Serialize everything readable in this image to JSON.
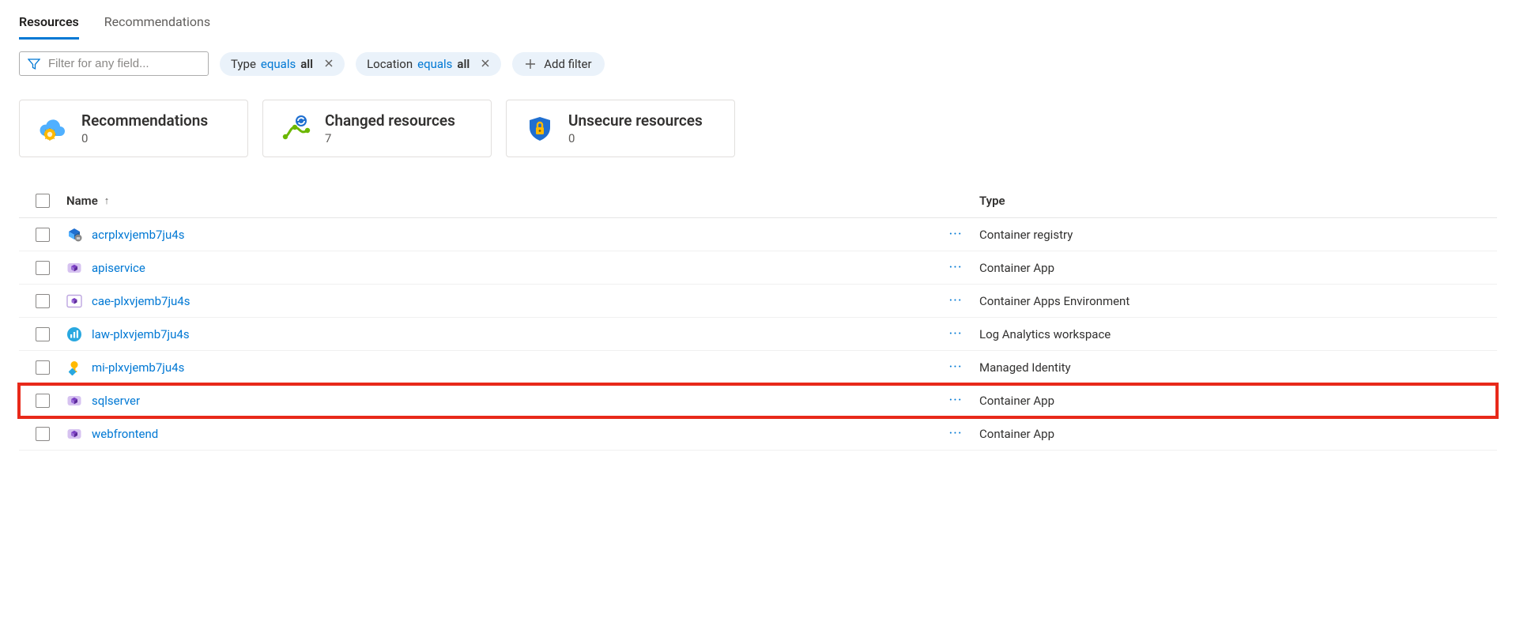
{
  "tabs": {
    "resources": "Resources",
    "recommendations": "Recommendations",
    "active": "resources"
  },
  "filters": {
    "placeholder": "Filter for any field...",
    "pills": [
      {
        "field": "Type",
        "op": "equals",
        "val": "all"
      },
      {
        "field": "Location",
        "op": "equals",
        "val": "all"
      }
    ],
    "add_label": "Add filter"
  },
  "cards": {
    "recommendations": {
      "title": "Recommendations",
      "count": "0"
    },
    "changed": {
      "title": "Changed resources",
      "count": "7"
    },
    "unsecure": {
      "title": "Unsecure resources",
      "count": "0"
    }
  },
  "columns": {
    "name": "Name",
    "type": "Type"
  },
  "rows": [
    {
      "name": "acrplxvjemb7ju4s",
      "type": "Container registry",
      "icon": "registry",
      "highlight": false
    },
    {
      "name": "apiservice",
      "type": "Container App",
      "icon": "containerapp",
      "highlight": false
    },
    {
      "name": "cae-plxvjemb7ju4s",
      "type": "Container Apps Environment",
      "icon": "caenv",
      "highlight": false
    },
    {
      "name": "law-plxvjemb7ju4s",
      "type": "Log Analytics workspace",
      "icon": "law",
      "highlight": false
    },
    {
      "name": "mi-plxvjemb7ju4s",
      "type": "Managed Identity",
      "icon": "identity",
      "highlight": false
    },
    {
      "name": "sqlserver",
      "type": "Container App",
      "icon": "containerapp",
      "highlight": true
    },
    {
      "name": "webfrontend",
      "type": "Container App",
      "icon": "containerapp",
      "highlight": false
    }
  ]
}
